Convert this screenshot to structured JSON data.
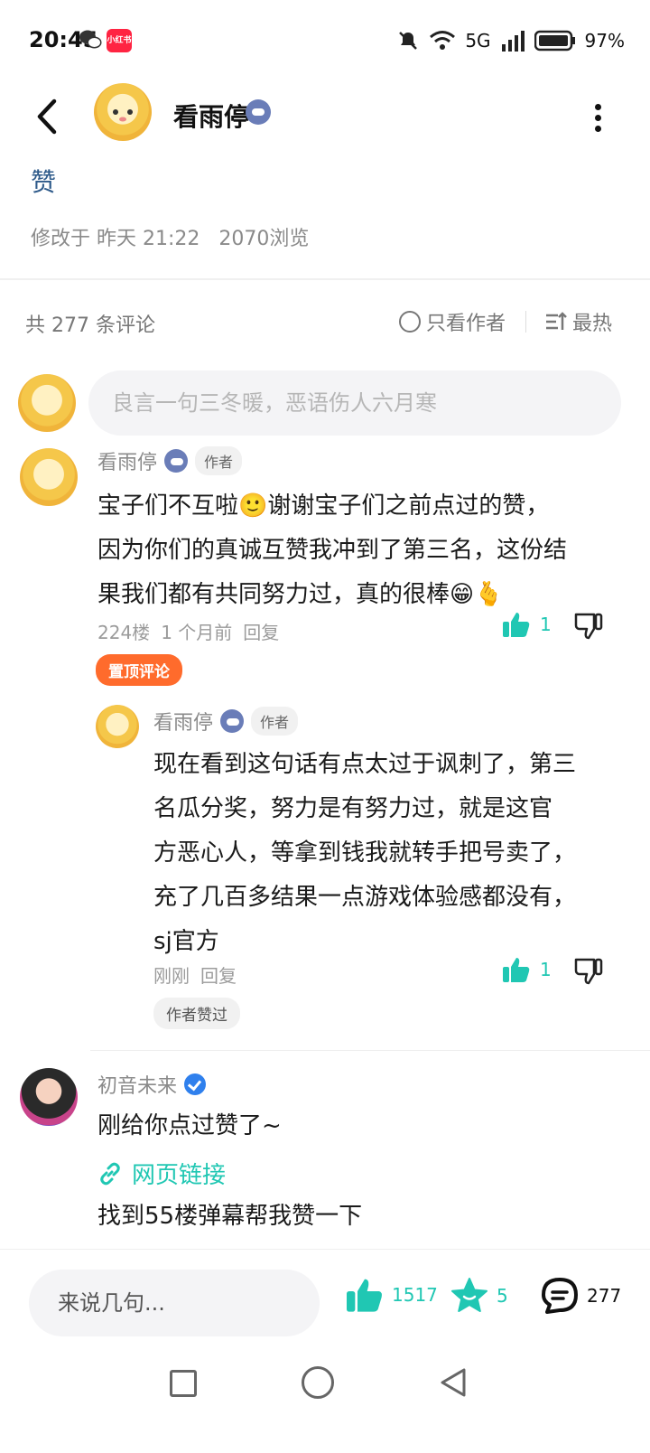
{
  "status_bar": {
    "time": "20:45",
    "xhs_label": "小红书",
    "network": "5G",
    "battery": "97%"
  },
  "header": {
    "author_name": "看雨停"
  },
  "post": {
    "body": "赞",
    "modified": "修改于 昨天 21:22",
    "views": "2070浏览"
  },
  "comments_header": {
    "count_label": "共 277 条评论",
    "author_only_label": "只看作者",
    "sort_label": "最热"
  },
  "comment_input": {
    "placeholder": "良言一句三冬暖，恶语伤人六月寒"
  },
  "comments": [
    {
      "author": "看雨停",
      "author_tag": "作者",
      "lines": [
        "宝子们不互啦🙂谢谢宝子们之前点过的赞，",
        "因为你们的真诚互赞我冲到了第三名，这份结",
        "果我们都有共同努力过，真的很棒😁🫰"
      ],
      "floor": "224楼",
      "time": "1 个月前",
      "reply_label": "回复",
      "likes": "1",
      "pin_label": "置顶评论"
    },
    {
      "author": "看雨停",
      "author_tag": "作者",
      "lines": [
        "现在看到这句话有点太过于讽刺了，第三",
        "名瓜分奖，努力是有努力过，就是这官",
        "方恶心人，等拿到钱我就转手把号卖了，",
        "充了几百多结果一点游戏体验感都没有，",
        "sj官方"
      ],
      "time": "刚刚",
      "reply_label": "回复",
      "likes": "1",
      "liked_label": "作者赞过"
    },
    {
      "author": "初音未来",
      "lines": [
        "刚给你点过赞了~"
      ],
      "link_label": "网页链接",
      "extra_line": "找到55楼弹幕帮我赞一下"
    }
  ],
  "bottom_bar": {
    "input_placeholder": "来说几句...",
    "likes": "1517",
    "favorites": "5",
    "comments": "277"
  },
  "colors": {
    "accent": "#20c7b3",
    "pin": "#ff6b2c",
    "post_text": "#2e5a8a"
  },
  "icons": {
    "back": "back-icon",
    "more": "more-icon",
    "like": "thumb-up-icon",
    "dislike": "thumb-down-icon",
    "star": "star-icon",
    "comment": "comment-icon",
    "link": "link-icon"
  }
}
